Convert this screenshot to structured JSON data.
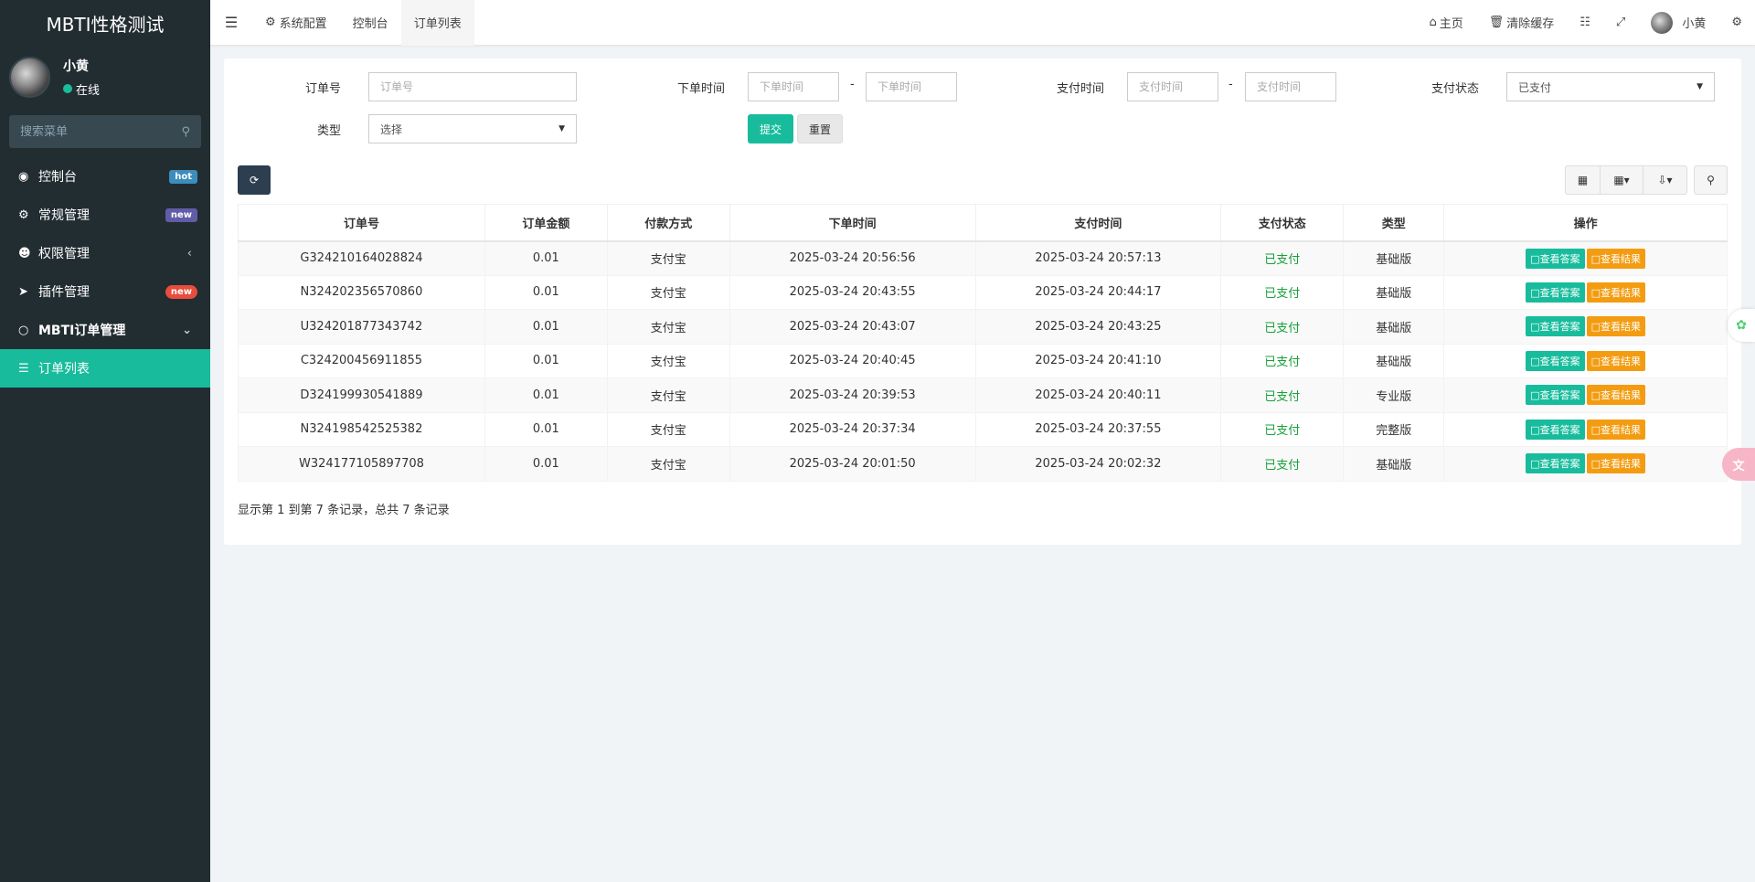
{
  "app": {
    "title": "MBTI性格测试"
  },
  "user": {
    "name": "小黄",
    "status": "在线"
  },
  "sidebar": {
    "search_placeholder": "搜索菜单",
    "items": [
      {
        "icon": "dashboard-icon",
        "label": "控制台",
        "badge": "hot"
      },
      {
        "icon": "cogs-icon",
        "label": "常规管理",
        "badge": "new"
      },
      {
        "icon": "users-icon",
        "label": "权限管理",
        "arrow": "‹"
      },
      {
        "icon": "rocket-icon",
        "label": "插件管理",
        "badge": "new"
      },
      {
        "icon": "circle-icon",
        "label": "MBTI订单管理",
        "arrow": "⌄"
      },
      {
        "icon": "list-icon",
        "label": "订单列表"
      }
    ]
  },
  "topbar": {
    "tabs": [
      "系统配置",
      "控制台",
      "订单列表"
    ],
    "active_tab": "订单列表",
    "home": "主页",
    "clear_cache": "清除缓存",
    "username": "小黄"
  },
  "filters": {
    "order_no_label": "订单号",
    "order_no_placeholder": "订单号",
    "order_time_label": "下单时间",
    "order_time_from_placeholder": "下单时间",
    "order_time_to_placeholder": "下单时间",
    "pay_time_label": "支付时间",
    "pay_time_from_placeholder": "支付时间",
    "pay_time_to_placeholder": "支付时间",
    "pay_status_label": "支付状态",
    "pay_status_value": "已支付",
    "type_label": "类型",
    "type_value": "选择",
    "range_sep": "-",
    "submit": "提交",
    "reset": "重置"
  },
  "table": {
    "headers": [
      "订单号",
      "订单金额",
      "付款方式",
      "下单时间",
      "支付时间",
      "支付状态",
      "类型",
      "操作"
    ],
    "rows": [
      {
        "order_no": "G324210164028824",
        "amount": "0.01",
        "pay_method": "支付宝",
        "order_time": "2025-03-24 20:56:56",
        "pay_time": "2025-03-24 20:57:13",
        "status": "已支付",
        "type": "基础版"
      },
      {
        "order_no": "N324202356570860",
        "amount": "0.01",
        "pay_method": "支付宝",
        "order_time": "2025-03-24 20:43:55",
        "pay_time": "2025-03-24 20:44:17",
        "status": "已支付",
        "type": "基础版"
      },
      {
        "order_no": "U324201877343742",
        "amount": "0.01",
        "pay_method": "支付宝",
        "order_time": "2025-03-24 20:43:07",
        "pay_time": "2025-03-24 20:43:25",
        "status": "已支付",
        "type": "基础版"
      },
      {
        "order_no": "C324200456911855",
        "amount": "0.01",
        "pay_method": "支付宝",
        "order_time": "2025-03-24 20:40:45",
        "pay_time": "2025-03-24 20:41:10",
        "status": "已支付",
        "type": "基础版"
      },
      {
        "order_no": "D324199930541889",
        "amount": "0.01",
        "pay_method": "支付宝",
        "order_time": "2025-03-24 20:39:53",
        "pay_time": "2025-03-24 20:40:11",
        "status": "已支付",
        "type": "专业版"
      },
      {
        "order_no": "N324198542525382",
        "amount": "0.01",
        "pay_method": "支付宝",
        "order_time": "2025-03-24 20:37:34",
        "pay_time": "2025-03-24 20:37:55",
        "status": "已支付",
        "type": "完整版"
      },
      {
        "order_no": "W324177105897708",
        "amount": "0.01",
        "pay_method": "支付宝",
        "order_time": "2025-03-24 20:01:50",
        "pay_time": "2025-03-24 20:02:32",
        "status": "已支付",
        "type": "基础版"
      }
    ],
    "view_answer": "查看答案",
    "view_result": "查看结果"
  },
  "pagination": {
    "summary": "显示第 1 到第 7 条记录，总共 7 条记录"
  },
  "colors": {
    "sidebar_bg": "#222d32",
    "accent": "#18bc9c",
    "orange": "#f39c12",
    "paid_green": "#18a03a"
  }
}
